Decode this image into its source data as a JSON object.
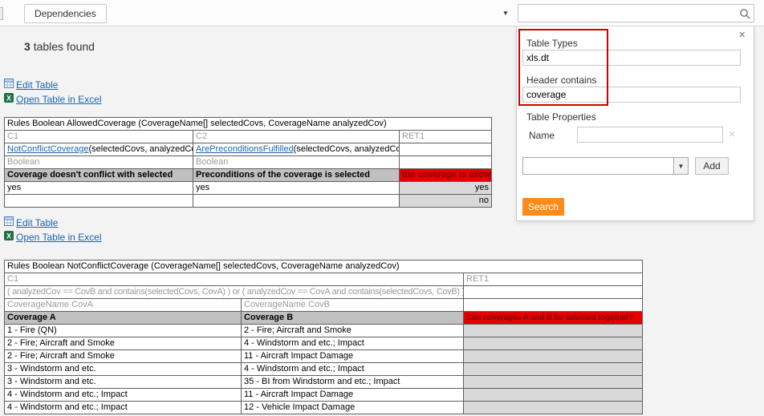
{
  "toolbar": {
    "dependencies_label": "Dependencies"
  },
  "results": {
    "count": "3",
    "label": "tables found"
  },
  "search": {
    "value": "",
    "placeholder": ""
  },
  "icons": {
    "caret_down": "▼",
    "close": "×",
    "clear": "×"
  },
  "search_panel": {
    "table_types_label": "Table Types",
    "table_types_value": "xls.dt",
    "header_contains_label": "Header contains",
    "header_contains_value": "coverage",
    "table_properties_label": "Table Properties",
    "name_label": "Name",
    "name_value": "",
    "property_select_value": "",
    "add_button_label": "Add",
    "search_button_label": "Search"
  },
  "table_actions": {
    "edit_label": "Edit Table",
    "excel_label": "Open Table in Excel"
  },
  "table1": {
    "title": "Rules Boolean AllowedCoverage (CoverageName[] selectedCovs, CoverageName analyzedCov)",
    "col_headers": [
      "C1",
      "C2",
      "RET1"
    ],
    "conditions": [
      {
        "name": "NotConflictCoverage",
        "args": "(selectedCovs, analyzedCov)"
      },
      {
        "name": "ArePreconditionsFulfilled",
        "args": "(selectedCovs, analyzedCov)"
      }
    ],
    "types": [
      "Boolean",
      "Boolean"
    ],
    "descriptions": [
      "Coverage doesn't conflict with selected",
      "Preconditions of the coverage is selected",
      "the coverage is allowed"
    ],
    "rows": [
      [
        "yes",
        "yes",
        "yes"
      ],
      [
        "",
        "",
        "no"
      ]
    ]
  },
  "table2": {
    "title": "Rules Boolean NotConflictCoverage (CoverageName[] selectedCovs, CoverageName analyzedCov)",
    "col_headers": [
      "C1",
      "RET1"
    ],
    "expression": "( analyzedCov == CovB and contains(selectedCovs, CovA) ) or ( analyzedCov == CovA and contains(selectedCovs, CovB) )",
    "param_headers": [
      "CoverageName CovA",
      "CoverageName CovB"
    ],
    "descriptions": [
      "Coverage A",
      "Coverage B",
      "Can coverages A and B be selected together?"
    ],
    "rows": [
      [
        "1 - Fire (QN)",
        "2 - Fire; Aircraft and Smoke"
      ],
      [
        "2 - Fire; Aircraft and Smoke",
        "4 - Windstorm and etc.; Impact"
      ],
      [
        "2 - Fire; Aircraft and Smoke",
        "11 - Aircraft Impact Damage"
      ],
      [
        "3 - Windstorm and etc.",
        "4 - Windstorm and etc.; Impact"
      ],
      [
        "3 - Windstorm and etc.",
        "35 - BI from Windstorm and etc.; Impact"
      ],
      [
        "4 - Windstorm and etc.; Impact",
        "11 - Aircraft Impact Damage"
      ],
      [
        "4 - Windstorm and etc.; Impact",
        "12 - Vehicle Impact Damage"
      ]
    ]
  },
  "colors": {
    "accent_orange": "#ff8c1a",
    "link_blue": "#1b66ad",
    "header_gray_bg": "#c0c0c0",
    "return_gray_bg": "#d9d9d9",
    "alert_red_bg": "#e60000",
    "alert_red_text": "#7d0000",
    "annotation_red": "#cc0000"
  }
}
